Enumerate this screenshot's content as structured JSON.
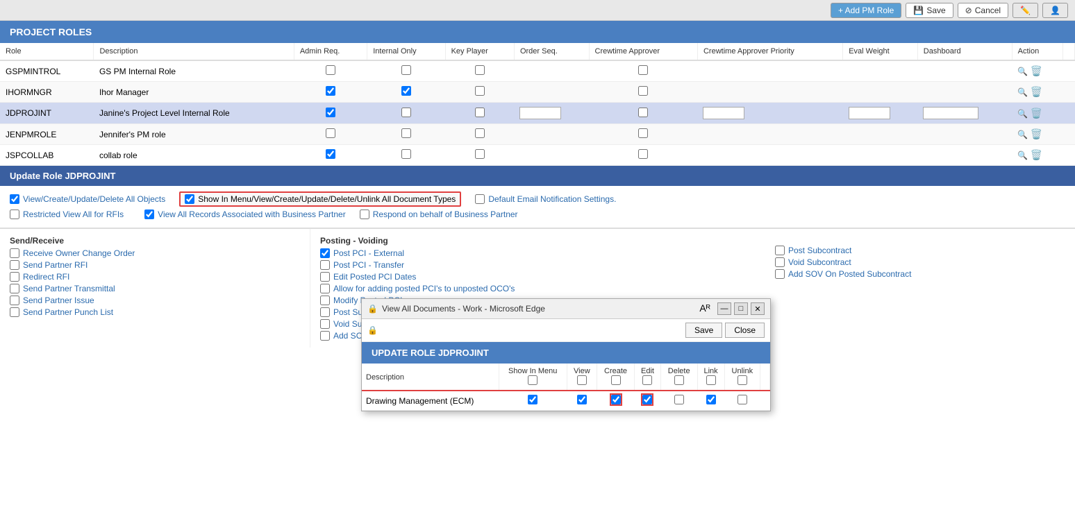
{
  "topbar": {
    "add_pm_role": "+ Add PM Role",
    "save": "Save",
    "cancel": "Cancel"
  },
  "page": {
    "title": "PROJECT ROLES"
  },
  "table": {
    "columns": [
      "Role",
      "Description",
      "Admin Req.",
      "Internal Only",
      "Key Player",
      "Order Seq.",
      "Crewtime Approver",
      "Crewtime Approver Priority",
      "Eval Weight",
      "Dashboard",
      "Action"
    ],
    "rows": [
      {
        "role": "GSPMINTROL",
        "description": "GS PM Internal Role",
        "admin_req": false,
        "internal_only": false,
        "key_player": false,
        "order_seq": "",
        "crewtime_approver": false,
        "crewtime_approver_priority": "",
        "eval_weight": "",
        "dashboard": "",
        "highlighted": false
      },
      {
        "role": "IHORMNGR",
        "description": "Ihor Manager",
        "admin_req": true,
        "internal_only": true,
        "key_player": false,
        "order_seq": "",
        "crewtime_approver": false,
        "crewtime_approver_priority": "",
        "eval_weight": "",
        "dashboard": "",
        "highlighted": false
      },
      {
        "role": "JDPROJINT",
        "description": "Janine's Project Level Internal Role",
        "admin_req": true,
        "internal_only": false,
        "key_player": false,
        "order_seq": "",
        "crewtime_approver": false,
        "crewtime_approver_priority": "",
        "eval_weight": "",
        "dashboard": "",
        "highlighted": true
      },
      {
        "role": "JENPMROLE",
        "description": "Jennifer's PM role",
        "admin_req": false,
        "internal_only": false,
        "key_player": false,
        "order_seq": "",
        "crewtime_approver": false,
        "crewtime_approver_priority": "",
        "eval_weight": "",
        "dashboard": "",
        "highlighted": false
      },
      {
        "role": "JSPCOLLAB",
        "description": "collab role",
        "admin_req": true,
        "internal_only": false,
        "key_player": false,
        "order_seq": "",
        "crewtime_approver": false,
        "crewtime_approver_priority": "",
        "eval_weight": "",
        "dashboard": "",
        "highlighted": false
      }
    ]
  },
  "update_role": {
    "title": "Update Role JDPROJINT"
  },
  "permissions": {
    "view_create_label": "View/Create/Update/Delete All Objects",
    "view_create_checked": true,
    "restricted_view_label": "Restricted View All for RFIs",
    "restricted_view_checked": false,
    "show_in_menu_label": "Show In Menu/View/Create/Update/Delete/Unlink All Document Types",
    "show_in_menu_checked": true,
    "view_all_records_label": "View All Records Associated with Business Partner",
    "view_all_records_checked": true,
    "default_email_label": "Default Email Notification Settings.",
    "default_email_checked": false,
    "respond_on_behalf_label": "Respond on behalf of Business Partner",
    "respond_on_behalf_checked": false
  },
  "send_receive": {
    "title": "Send/Receive",
    "items": [
      {
        "label": "Receive Owner Change Order",
        "checked": false
      },
      {
        "label": "Send Partner RFI",
        "checked": false
      },
      {
        "label": "Redirect RFI",
        "checked": false
      },
      {
        "label": "Send Partner Transmittal",
        "checked": false
      },
      {
        "label": "Send Partner Issue",
        "checked": false
      },
      {
        "label": "Send Partner Punch List",
        "checked": false
      }
    ]
  },
  "posting_voiding": {
    "title": "Posting - Voiding",
    "items": [
      {
        "label": "Post PCI - External",
        "checked": true
      },
      {
        "label": "Post PCI - Transfer",
        "checked": false
      },
      {
        "label": "Edit Posted PCI Dates",
        "checked": false
      },
      {
        "label": "Allow for adding posted PCI's to unposted OCO's",
        "checked": false
      },
      {
        "label": "Modify Posted PCI",
        "checked": false
      },
      {
        "label": "Post Subcontract Change Order",
        "checked": false
      },
      {
        "label": "Void Subcontract Change Order",
        "checked": false
      },
      {
        "label": "Add SOV On Subcontract Change Order",
        "checked": false
      }
    ]
  },
  "right_column": {
    "items": [
      {
        "label": "Post Subcontract",
        "checked": false
      },
      {
        "label": "Void Subcontract",
        "checked": false
      },
      {
        "label": "Add SOV On Posted Subcontract",
        "checked": false
      }
    ]
  },
  "floating_window": {
    "title": "View All Documents - Work - Microsoft Edge",
    "role_header": "UPDATE ROLE JDPROJINT",
    "save_btn": "Save",
    "close_btn": "Close",
    "table_columns": [
      "Description",
      "Show In Menu",
      "View",
      "Create",
      "Edit",
      "Delete",
      "Link",
      "Unlink"
    ],
    "rows": [
      {
        "description": "Drawing Management (ECM)",
        "show_in_menu": true,
        "view": true,
        "create": true,
        "edit": true,
        "delete": false,
        "link": true,
        "unlink": false,
        "highlighted": true
      }
    ],
    "header_checkboxes": {
      "show_in_menu": false,
      "view": false,
      "create": false,
      "edit": false,
      "delete": false,
      "link": false,
      "unlink": false
    }
  }
}
